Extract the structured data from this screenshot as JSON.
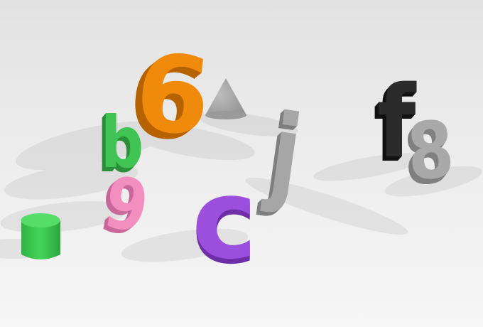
{
  "scene": {
    "objects": [
      {
        "kind": "glyph",
        "char": "6",
        "color": "#f08a0c",
        "shade": "#b76200"
      },
      {
        "kind": "glyph",
        "char": "b",
        "color": "#3fc352",
        "shade": "#2a8f38"
      },
      {
        "kind": "glyph",
        "char": "9",
        "color": "#f28fbf",
        "shade": "#c8689a"
      },
      {
        "kind": "glyph",
        "char": "c",
        "color": "#9b4fdc",
        "shade": "#6d2fa8"
      },
      {
        "kind": "glyph",
        "char": "j",
        "color": "#a6a6a6",
        "shade": "#7f7f7f"
      },
      {
        "kind": "glyph",
        "char": "f",
        "color": "#2b2b2b",
        "shade": "#111111"
      },
      {
        "kind": "glyph",
        "char": "8",
        "color": "#a9a9a9",
        "shade": "#808080"
      },
      {
        "kind": "shape",
        "shape": "cone",
        "color": "#a4a4a4"
      },
      {
        "kind": "shape",
        "shape": "cylinder",
        "color": "#39c94f"
      }
    ]
  }
}
